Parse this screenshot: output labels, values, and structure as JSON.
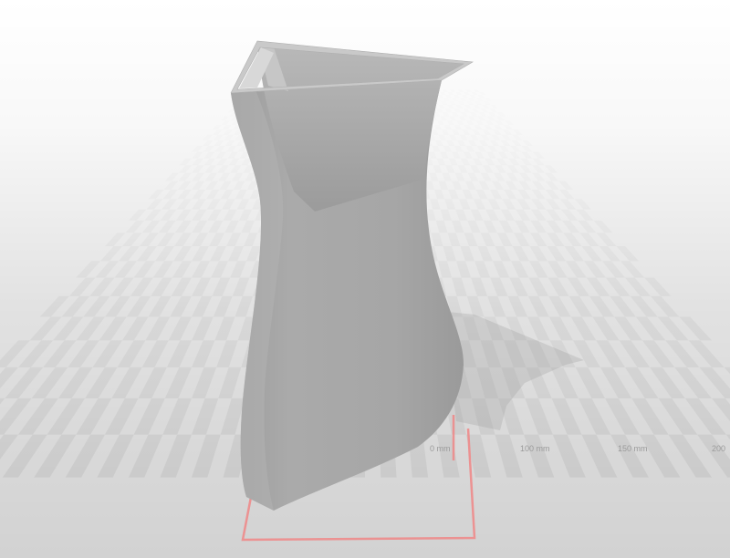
{
  "viewer": {
    "ruler_labels": [
      "0 mm",
      "100 mm",
      "150 mm",
      "200"
    ]
  },
  "colors": {
    "floor_light": "#d2d2d2",
    "floor_dark": "#c4c4c4",
    "model_body": "#a8a8a8",
    "model_highlight": "#b4b4b4",
    "model_shadow": "#8f8f8f",
    "build_outline": "#ee8b8b"
  },
  "model": {
    "name_icon": "vase-icon"
  }
}
